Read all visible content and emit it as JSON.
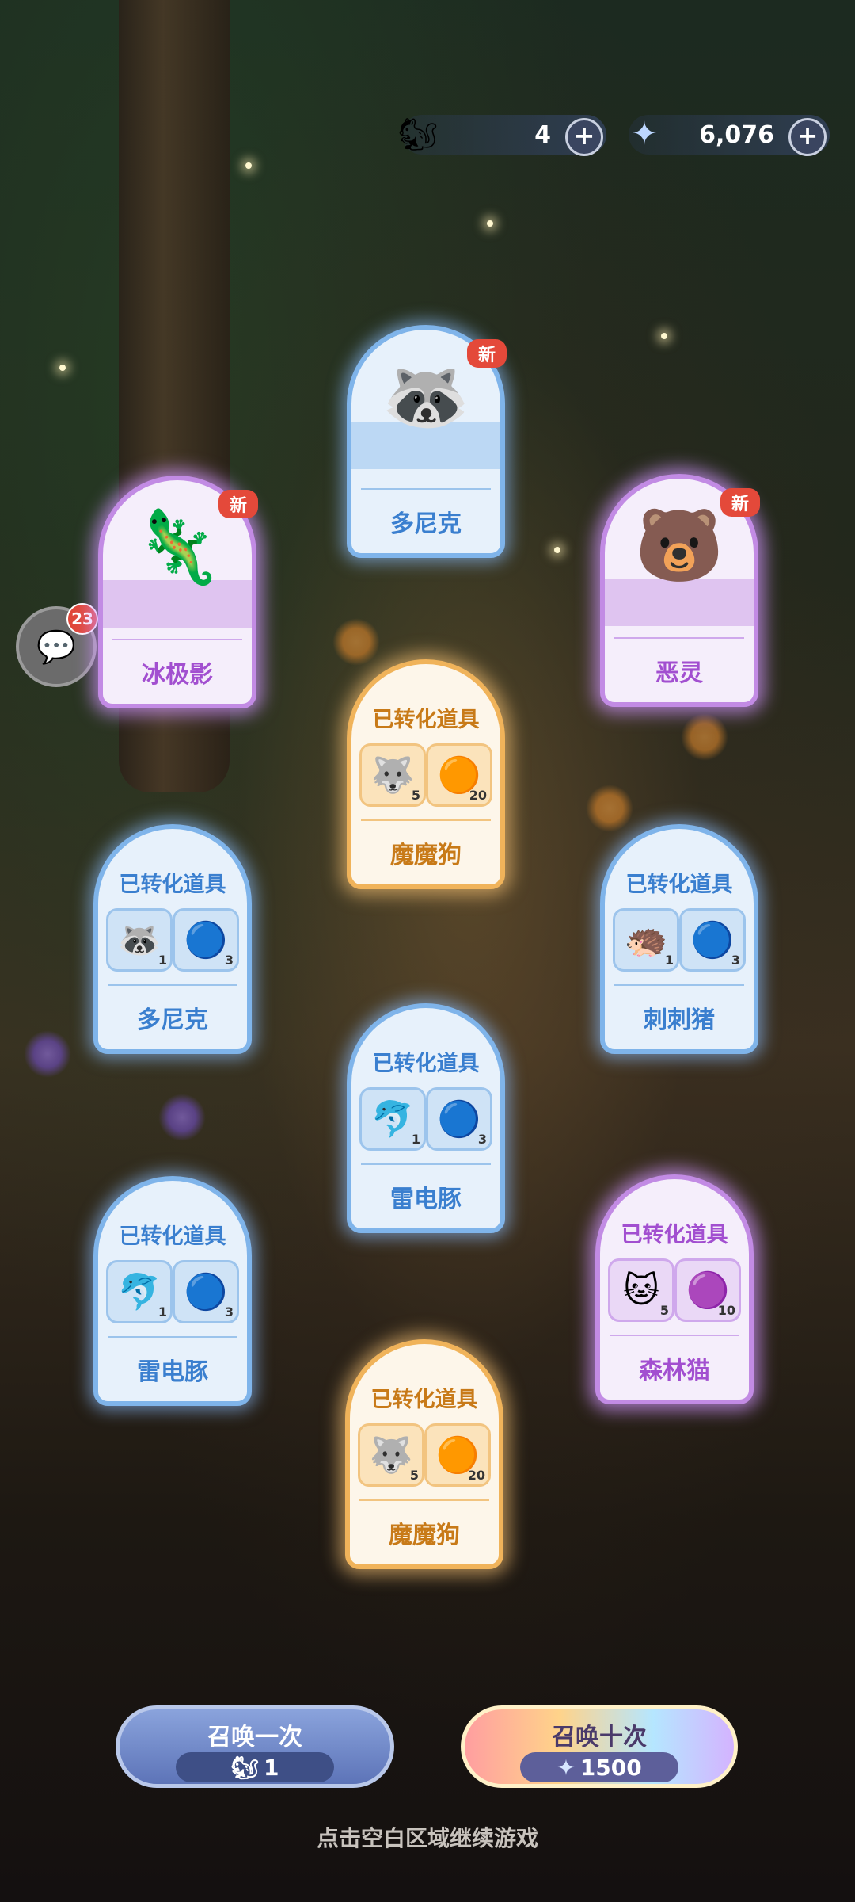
{
  "currency": {
    "tickets": {
      "icon": "squirrel-ticket-icon",
      "value": "4"
    },
    "crystals": {
      "icon": "star-crystal-icon",
      "value": "6,076"
    }
  },
  "chat": {
    "unread": "23"
  },
  "new_badge": "新",
  "pets": [
    {
      "name": "多尼克",
      "color": "blue",
      "new": true,
      "emoji": "🦝"
    },
    {
      "name": "冰极影",
      "color": "purple",
      "new": true,
      "emoji": "🦎"
    },
    {
      "name": "恶灵",
      "color": "purple",
      "new": true,
      "emoji": "🐻"
    }
  ],
  "converted_title": "已转化道具",
  "converted": [
    {
      "name": "魔魔狗",
      "color": "orange",
      "items": [
        {
          "emoji": "🐺",
          "count": "5"
        },
        {
          "emoji": "🟠",
          "count": "20"
        }
      ]
    },
    {
      "name": "多尼克",
      "color": "blue",
      "items": [
        {
          "emoji": "🦝",
          "count": "1"
        },
        {
          "emoji": "🔵",
          "count": "3"
        }
      ]
    },
    {
      "name": "刺刺猪",
      "color": "blue",
      "items": [
        {
          "emoji": "🦔",
          "count": "1"
        },
        {
          "emoji": "🔵",
          "count": "3"
        }
      ]
    },
    {
      "name": "雷电豚",
      "color": "blue",
      "items": [
        {
          "emoji": "🐬",
          "count": "1"
        },
        {
          "emoji": "🔵",
          "count": "3"
        }
      ]
    },
    {
      "name": "雷电豚",
      "color": "blue",
      "items": [
        {
          "emoji": "🐬",
          "count": "1"
        },
        {
          "emoji": "🔵",
          "count": "3"
        }
      ]
    },
    {
      "name": "森林猫",
      "color": "purple",
      "items": [
        {
          "emoji": "🐱",
          "count": "5"
        },
        {
          "emoji": "🟣",
          "count": "10"
        }
      ]
    },
    {
      "name": "魔魔狗",
      "color": "orange",
      "items": [
        {
          "emoji": "🐺",
          "count": "5"
        },
        {
          "emoji": "🟠",
          "count": "20"
        }
      ]
    }
  ],
  "buttons": {
    "summon_one": {
      "label": "召唤一次",
      "cost": "1",
      "cost_icon": "squirrel-ticket-icon"
    },
    "summon_ten": {
      "label": "召唤十次",
      "cost": "1500",
      "cost_icon": "star-crystal-icon"
    }
  },
  "hint": "点击空白区域继续游戏"
}
